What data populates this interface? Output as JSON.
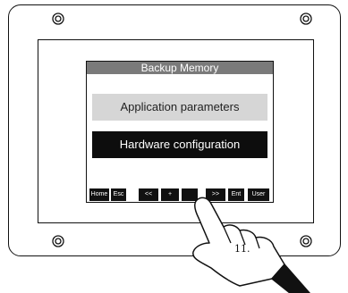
{
  "screen": {
    "title": "Backup Memory",
    "buttons": {
      "application": "Application parameters",
      "hardware": "Hardware configuration"
    },
    "keys": [
      "Home",
      "Esc",
      "<<",
      "+",
      "",
      ">>",
      "Ent",
      "User"
    ]
  },
  "annotation": {
    "step": "11."
  }
}
